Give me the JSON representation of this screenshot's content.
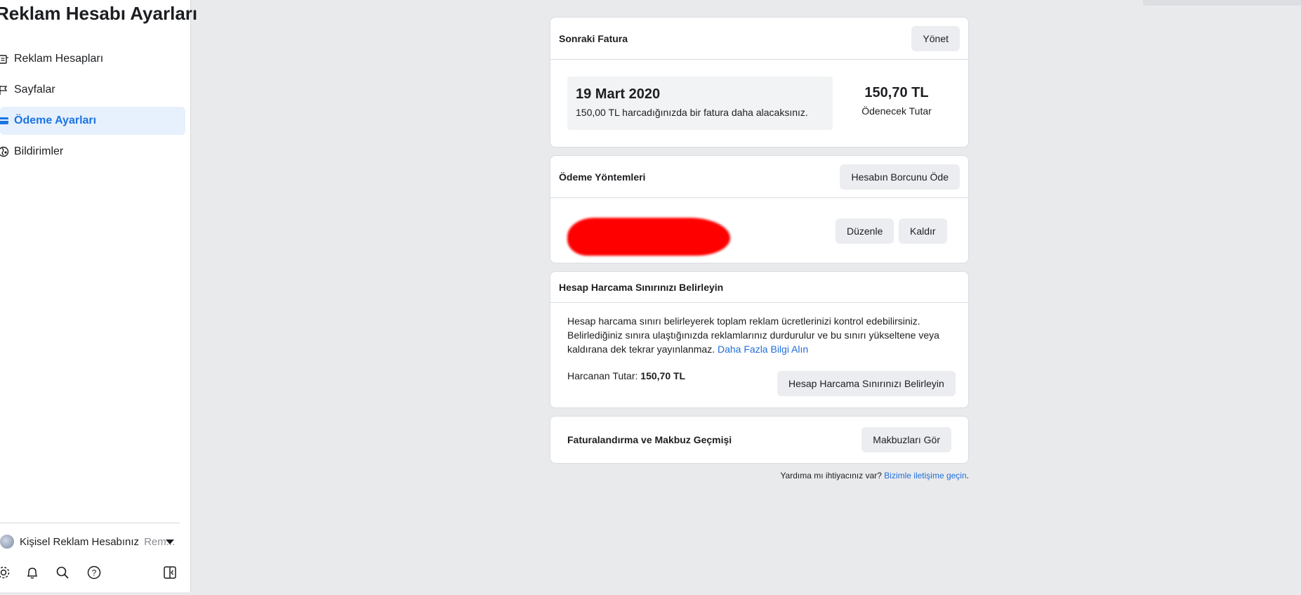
{
  "sidebar": {
    "title": "Reklam Hesabı Ayarları",
    "items": [
      {
        "label": "Reklam Hesapları"
      },
      {
        "label": "Sayfalar"
      },
      {
        "label": "Ödeme Ayarları"
      },
      {
        "label": "Bildirimler"
      }
    ],
    "account": {
      "name": "Kişisel Reklam Hesabınız",
      "sub": "Rem..."
    },
    "active_color": "#1b74e4"
  },
  "next_invoice": {
    "title": "Sonraki Fatura",
    "manage_label": "Yönet",
    "date": "19 Mart 2020",
    "description": "150,00 TL harcadığınızda bir fatura daha alacaksınız.",
    "amount": "150,70 TL",
    "amount_label": "Ödenecek Tutar"
  },
  "payment_methods": {
    "title": "Ödeme Yöntemleri",
    "pay_balance_label": "Hesabın Borcunu Öde",
    "edit_label": "Düzenle",
    "remove_label": "Kaldır"
  },
  "spend_limit": {
    "title": "Hesap Harcama Sınırınızı Belirleyin",
    "line1": "Hesap harcama sınırı belirleyerek toplam reklam ücretlerinizi kontrol edebilirsiniz.",
    "line2": "Belirlediğiniz sınıra ulaştığınızda reklamlarınız durdurulur ve bu sınırı yükseltene veya",
    "line3": "kaldırana dek tekrar yayınlanmaz.",
    "learn_more": "Daha Fazla Bilgi Alın",
    "spent_label": "Harcanan Tutar:",
    "spent_value": "150,70 TL",
    "button_label": "Hesap Harcama Sınırınızı Belirleyin"
  },
  "billing_history": {
    "title": "Faturalandırma ve Makbuz Geçmişi",
    "button_label": "Makbuzları Gör"
  },
  "footer": {
    "text": "Yardıma mı ihtiyacınız var?",
    "link": "Bizimle iletişime geçin",
    "end": "."
  }
}
